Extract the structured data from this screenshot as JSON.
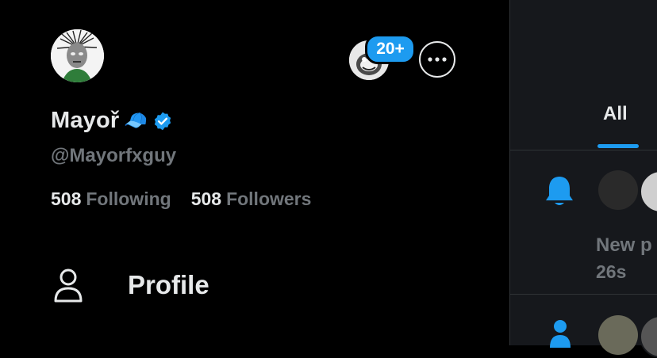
{
  "drawer": {
    "user": {
      "display_name": "Mayoř",
      "name_emoji": "🧢",
      "verified_icon": "verified-badge-icon",
      "handle": "@Mayorfxguy",
      "avatar_icon": "user-avatar",
      "following_count": "508",
      "following_label": "Following",
      "followers_count": "508",
      "followers_label": "Followers"
    },
    "account_switcher": {
      "badge": "20+"
    },
    "more_icon": "more-options-icon",
    "menu": [
      {
        "label": "Profile",
        "icon": "person-icon"
      }
    ]
  },
  "notifications_panel": {
    "tab_all": "All",
    "notification": {
      "icon": "bell-icon",
      "text": "New p",
      "time": "26s"
    },
    "accent": "#1d9bf0"
  },
  "colors": {
    "background": "#000000",
    "text": "#e7e9ea",
    "muted": "#71767b",
    "accent": "#1d9bf0"
  }
}
